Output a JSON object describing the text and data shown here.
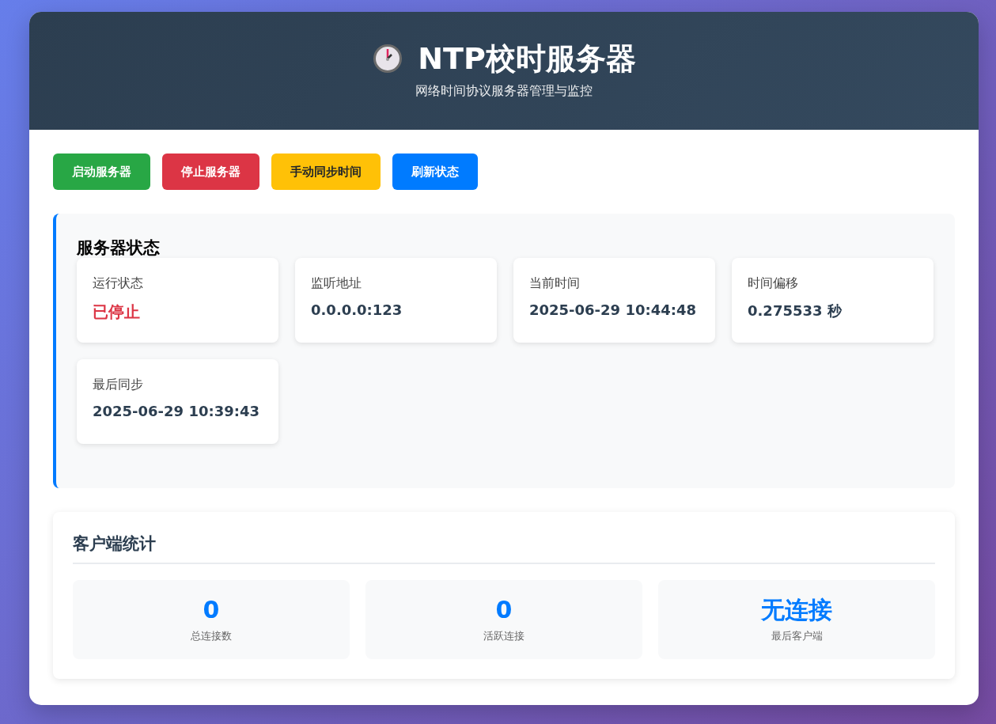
{
  "header": {
    "title": "NTP校时服务器",
    "subtitle": "网络时间协议服务器管理与监控"
  },
  "buttons": [
    {
      "label": "启动服务器",
      "kind": "success"
    },
    {
      "label": "停止服务器",
      "kind": "danger"
    },
    {
      "label": "手动同步时间",
      "kind": "warning"
    },
    {
      "label": "刷新状态",
      "kind": "primary"
    }
  ],
  "server_status": {
    "title": "服务器状态",
    "items": [
      {
        "label": "运行状态",
        "value": "已停止",
        "kind": "status",
        "running": false
      },
      {
        "label": "监听地址",
        "value": "0.0.0.0:123",
        "kind": "text"
      },
      {
        "label": "当前时间",
        "value": "2025-06-29 10:44:48",
        "kind": "text"
      },
      {
        "label": "时间偏移",
        "value": "0.275533 秒",
        "kind": "text"
      },
      {
        "label": "最后同步",
        "value": "2025-06-29 10:39:43",
        "kind": "text"
      }
    ]
  },
  "client_stats": {
    "title": "客户端统计",
    "items": [
      {
        "value": "0",
        "label": "总连接数"
      },
      {
        "value": "0",
        "label": "活跃连接"
      },
      {
        "value": "无连接",
        "label": "最后客户端"
      }
    ]
  }
}
